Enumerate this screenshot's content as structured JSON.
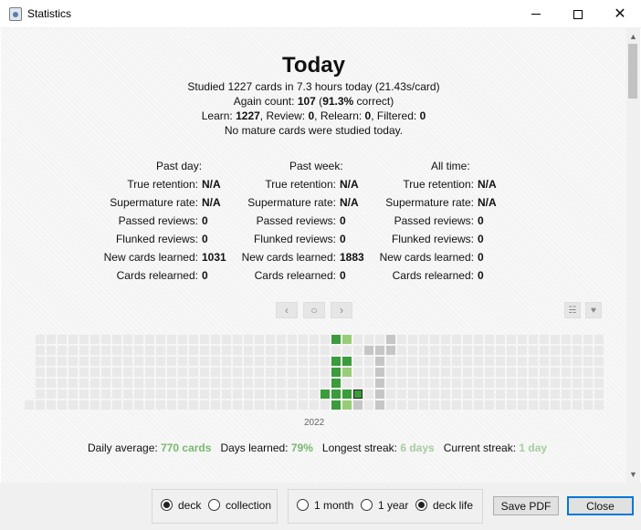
{
  "window": {
    "title": "Statistics"
  },
  "today": {
    "heading": "Today",
    "line1": "Studied 1227 cards in 7.3 hours today (21.43s/card)",
    "again_label": "Again count: ",
    "again_count": "107",
    "again_pct": "91.3%",
    "again_suffix": " correct)",
    "learn_label": "Learn: ",
    "learn_value": "1227",
    "review_label": ", Review: ",
    "review_value": "0",
    "relearn_label": ", Relearn: ",
    "relearn_value": "0",
    "filtered_label": ", Filtered: ",
    "filtered_value": "0",
    "mature_note": "No mature cards were studied today."
  },
  "periods": [
    {
      "heading": "Past day:",
      "rows": [
        {
          "label": "True retention:",
          "value": "N/A"
        },
        {
          "label": "Supermature rate:",
          "value": "N/A"
        },
        {
          "label": "Passed reviews:",
          "value": "0"
        },
        {
          "label": "Flunked reviews:",
          "value": "0"
        },
        {
          "label": "New cards learned:",
          "value": "1031"
        },
        {
          "label": "Cards relearned:",
          "value": "0"
        }
      ]
    },
    {
      "heading": "Past week:",
      "rows": [
        {
          "label": "True retention:",
          "value": "N/A"
        },
        {
          "label": "Supermature rate:",
          "value": "N/A"
        },
        {
          "label": "Passed reviews:",
          "value": "0"
        },
        {
          "label": "Flunked reviews:",
          "value": "0"
        },
        {
          "label": "New cards learned:",
          "value": "1883"
        },
        {
          "label": "Cards relearned:",
          "value": "0"
        }
      ]
    },
    {
      "heading": "All time:",
      "rows": [
        {
          "label": "True retention:",
          "value": "N/A"
        },
        {
          "label": "Supermature rate:",
          "value": "N/A"
        },
        {
          "label": "Passed reviews:",
          "value": "0"
        },
        {
          "label": "Flunked reviews:",
          "value": "0"
        },
        {
          "label": "New cards learned:",
          "value": "0"
        },
        {
          "label": "Cards relearned:",
          "value": "0"
        }
      ]
    }
  ],
  "heatmap_nav": {
    "prev_icon": "chevron-left-icon",
    "today_icon": "circle-icon",
    "next_icon": "chevron-right-icon",
    "options_icon": "sliders-icon",
    "heart_icon": "heart-icon"
  },
  "heatmap": {
    "year_label": "2022",
    "colors": {
      "empty": "#e9e9e9",
      "dark": "#3a9c3a",
      "light": "#99cc77",
      "future": "#c6c6c6",
      "today_border": "#222222"
    }
  },
  "summary": {
    "daily_avg_label": "Daily average:",
    "daily_avg_value": "770 cards",
    "days_learned_label": "Days learned:",
    "days_learned_value": "79%",
    "longest_streak_label": "Longest streak:",
    "longest_streak_value": "6 days",
    "current_streak_label": "Current streak:",
    "current_streak_value": "1 day",
    "value_color": "#7ab870"
  },
  "scope": {
    "deck": "deck",
    "collection": "collection",
    "selected": "deck"
  },
  "range": {
    "month": "1 month",
    "year": "1 year",
    "deck_life": "deck life",
    "selected": "deck life"
  },
  "buttons": {
    "save_pdf": "Save PDF",
    "close": "Close"
  }
}
